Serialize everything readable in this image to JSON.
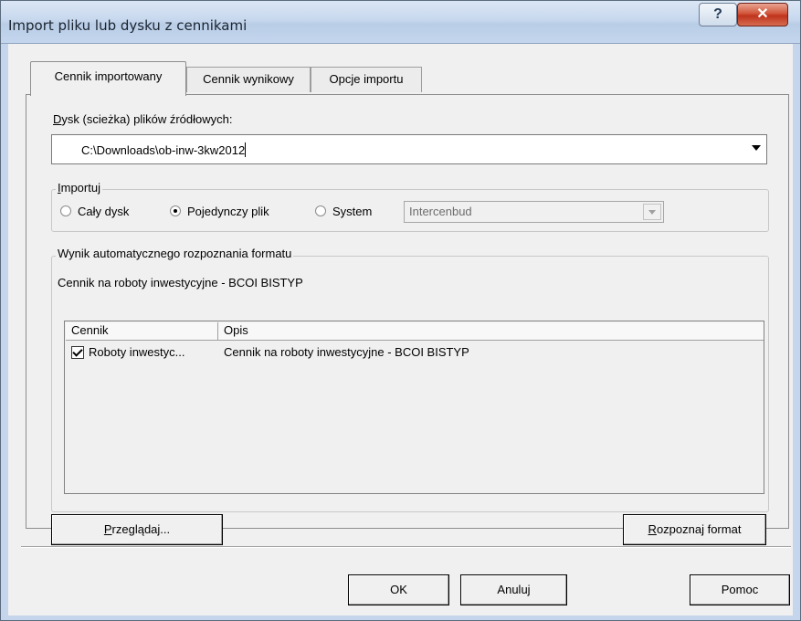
{
  "window": {
    "title": "Import pliku lub dysku z cennikami",
    "help_glyph": "?",
    "close_glyph": "✕"
  },
  "tabs": [
    {
      "label": "Cennik importowany",
      "active": true
    },
    {
      "label": "Cennik wynikowy",
      "active": false
    },
    {
      "label": "Opcje importu",
      "active": false
    }
  ],
  "source": {
    "label_first": "D",
    "label_rest": "ysk (scieżka) plików źródłowych:",
    "value": "C:\\Downloads\\ob-inw-3kw2012"
  },
  "import_group": {
    "title_first": "I",
    "title_rest": "mportuj",
    "options": [
      "Cały dysk",
      "Pojedynczy plik",
      "System"
    ],
    "selected": "Pojedynczy plik",
    "system_value": "Intercenbud"
  },
  "detect_group": {
    "title": "Wynik automatycznego rozpoznania formatu",
    "result": "Cennik na roboty inwestycyjne - BCOI BISTYP",
    "columns": [
      "Cennik",
      "Opis"
    ],
    "rows": [
      {
        "checked": true,
        "cennik": "Roboty inwestyc...",
        "opis": "Cennik na roboty inwestycyjne - BCOI BISTYP"
      }
    ]
  },
  "buttons": {
    "browse_first": "P",
    "browse_rest": "rzeglądaj...",
    "detect_first": "R",
    "detect_rest": "ozpoznaj format",
    "ok": "OK",
    "cancel": "Anuluj",
    "help": "Pomoc"
  }
}
